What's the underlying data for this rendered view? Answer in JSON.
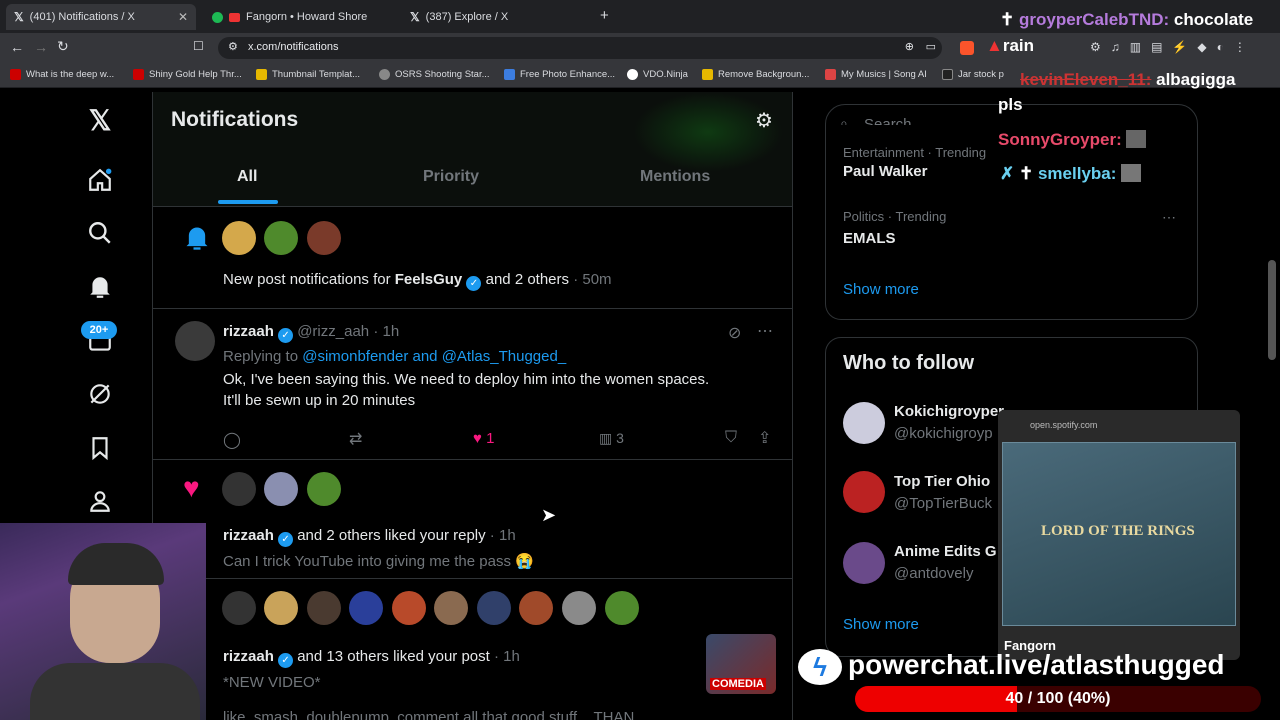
{
  "browser": {
    "tabs": [
      {
        "title": "(401) Notifications / X",
        "active": true
      },
      {
        "title": "Fangorn • Howard Shore",
        "active": false
      },
      {
        "title": "(387) Explore / X",
        "active": false
      }
    ],
    "new_tab": "+",
    "url": "x.com/notifications",
    "bookmarks": [
      "What is the deep w...",
      "Shiny Gold Help Thr...",
      "Thumbnail Templat...",
      "OSRS Shooting Star...",
      "Free Photo Enhance...",
      "VDO.Ninja",
      "Remove Backgroun...",
      "My Musics | Song AI",
      "Jar stock p"
    ],
    "bookmarks_more": "»"
  },
  "nav": {
    "badge": "20+"
  },
  "header": {
    "title": "Notifications",
    "tabs": [
      "All",
      "Priority",
      "Mentions"
    ]
  },
  "feed": {
    "n1": {
      "text_pre": "New post notifications for ",
      "name": "FeelsGuy",
      "text_post": " and 2 others",
      "time": "· 50m"
    },
    "n2": {
      "name": "rizzaah",
      "handle": "@rizz_aah",
      "time": "· 1h",
      "replying_label": "Replying to ",
      "reply_to": "@simonbfender and @Atlas_Thugged_",
      "body_line1": "Ok, I've been saying this. We need to deploy him into the women spaces.",
      "body_line2": "It'll be sewn up in 20 minutes",
      "likes": "1",
      "views": "3"
    },
    "n3": {
      "name": "rizzaah",
      "text": " and 2 others liked your reply",
      "time": " · 1h",
      "body": "Can I trick YouTube into giving me the pass 😭"
    },
    "n4": {
      "name": "rizzaah",
      "text": " and 13 others liked your post",
      "time": " · 1h",
      "body": "*NEW VIDEO*",
      "body2": "like, smash, doublepump, comment all that good stuff... THAN"
    }
  },
  "sidebar": {
    "search_placeholder": "Search",
    "trend1": {
      "meta": "Entertainment · Trending",
      "title": "Paul Walker"
    },
    "trend2": {
      "meta": "Politics · Trending",
      "title": "EMALS"
    },
    "show_more": "Show more",
    "who_title": "Who to follow",
    "follow": [
      {
        "name": "Kokichigroyper",
        "handle": "@kokichigroyp"
      },
      {
        "name": "Top Tier Ohio",
        "handle": "@TopTierBuck"
      },
      {
        "name": "Anime Edits G",
        "handle": "@antdovely"
      }
    ],
    "show_more2": "Show more"
  },
  "stream": {
    "chat": [
      {
        "user": "groyperCalebTND:",
        "msg": "chocolate",
        "msg2": "rain"
      },
      {
        "user": "kevinEleven_11:",
        "msg": "albagigga",
        "msg2": "pls"
      },
      {
        "user": "SonnyGroyper:",
        "msg": ""
      },
      {
        "user": "smellyba:",
        "msg": ""
      }
    ],
    "spotify_url": "open.spotify.com",
    "album_title": "LORD OF THE RINGS",
    "song": "Fangorn",
    "powerchat": "powerchat.live/atlasthugged",
    "goal": "40 / 100 (40%)",
    "goal_progress": 0.4,
    "comedia": "COMEDIA"
  }
}
